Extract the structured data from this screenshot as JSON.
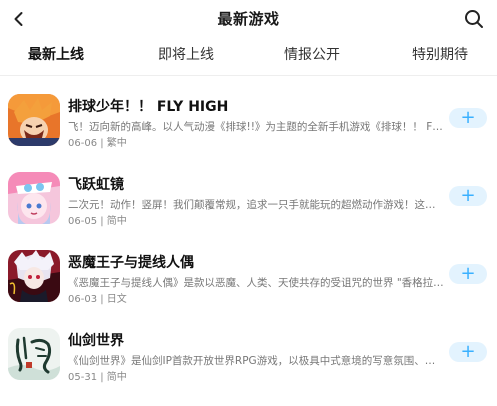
{
  "header": {
    "title": "最新游戏",
    "back_icon": "back-arrow-icon",
    "search_icon": "search-icon"
  },
  "tabs": [
    {
      "label": "最新上线",
      "active": true
    },
    {
      "label": "即将上线",
      "active": false
    },
    {
      "label": "情报公开",
      "active": false
    },
    {
      "label": "特别期待",
      "active": false
    }
  ],
  "colors": {
    "accent": "#3ab7ff",
    "add_button_bg": "#e3f3fe",
    "add_button_fg": "#3ab0ff"
  },
  "games": [
    {
      "title": "排球少年！！ FLY HIGH",
      "description": "飞！迈向新的高峰。以人气动漫《排球!!》为主题的全新手机游戏《排球！！ FLY H...",
      "meta": "06-06 | 繁中",
      "add_label": "+"
    },
    {
      "title": "飞跃虹镜",
      "description": "二次元！动作！竖屏！我们颠覆常规，追求一只手就能玩的超燃动作游戏！这可不...",
      "meta": "06-05 | 简中",
      "add_label": "+"
    },
    {
      "title": "恶魔王子与提线人偶",
      "description": "《恶魔王子与提线人偶》是款以恶魔、人类、天使共存的受诅咒的世界 \"香格拉\" 为...",
      "meta": "06-03 | 日文",
      "add_label": "+"
    },
    {
      "title": "仙剑世界",
      "description": "《仙剑世界》是仙剑IP首款开放世界RPG游戏，以极具中式意境的写意氛围、万物...",
      "meta": "05-31 | 简中",
      "add_label": "+"
    }
  ]
}
